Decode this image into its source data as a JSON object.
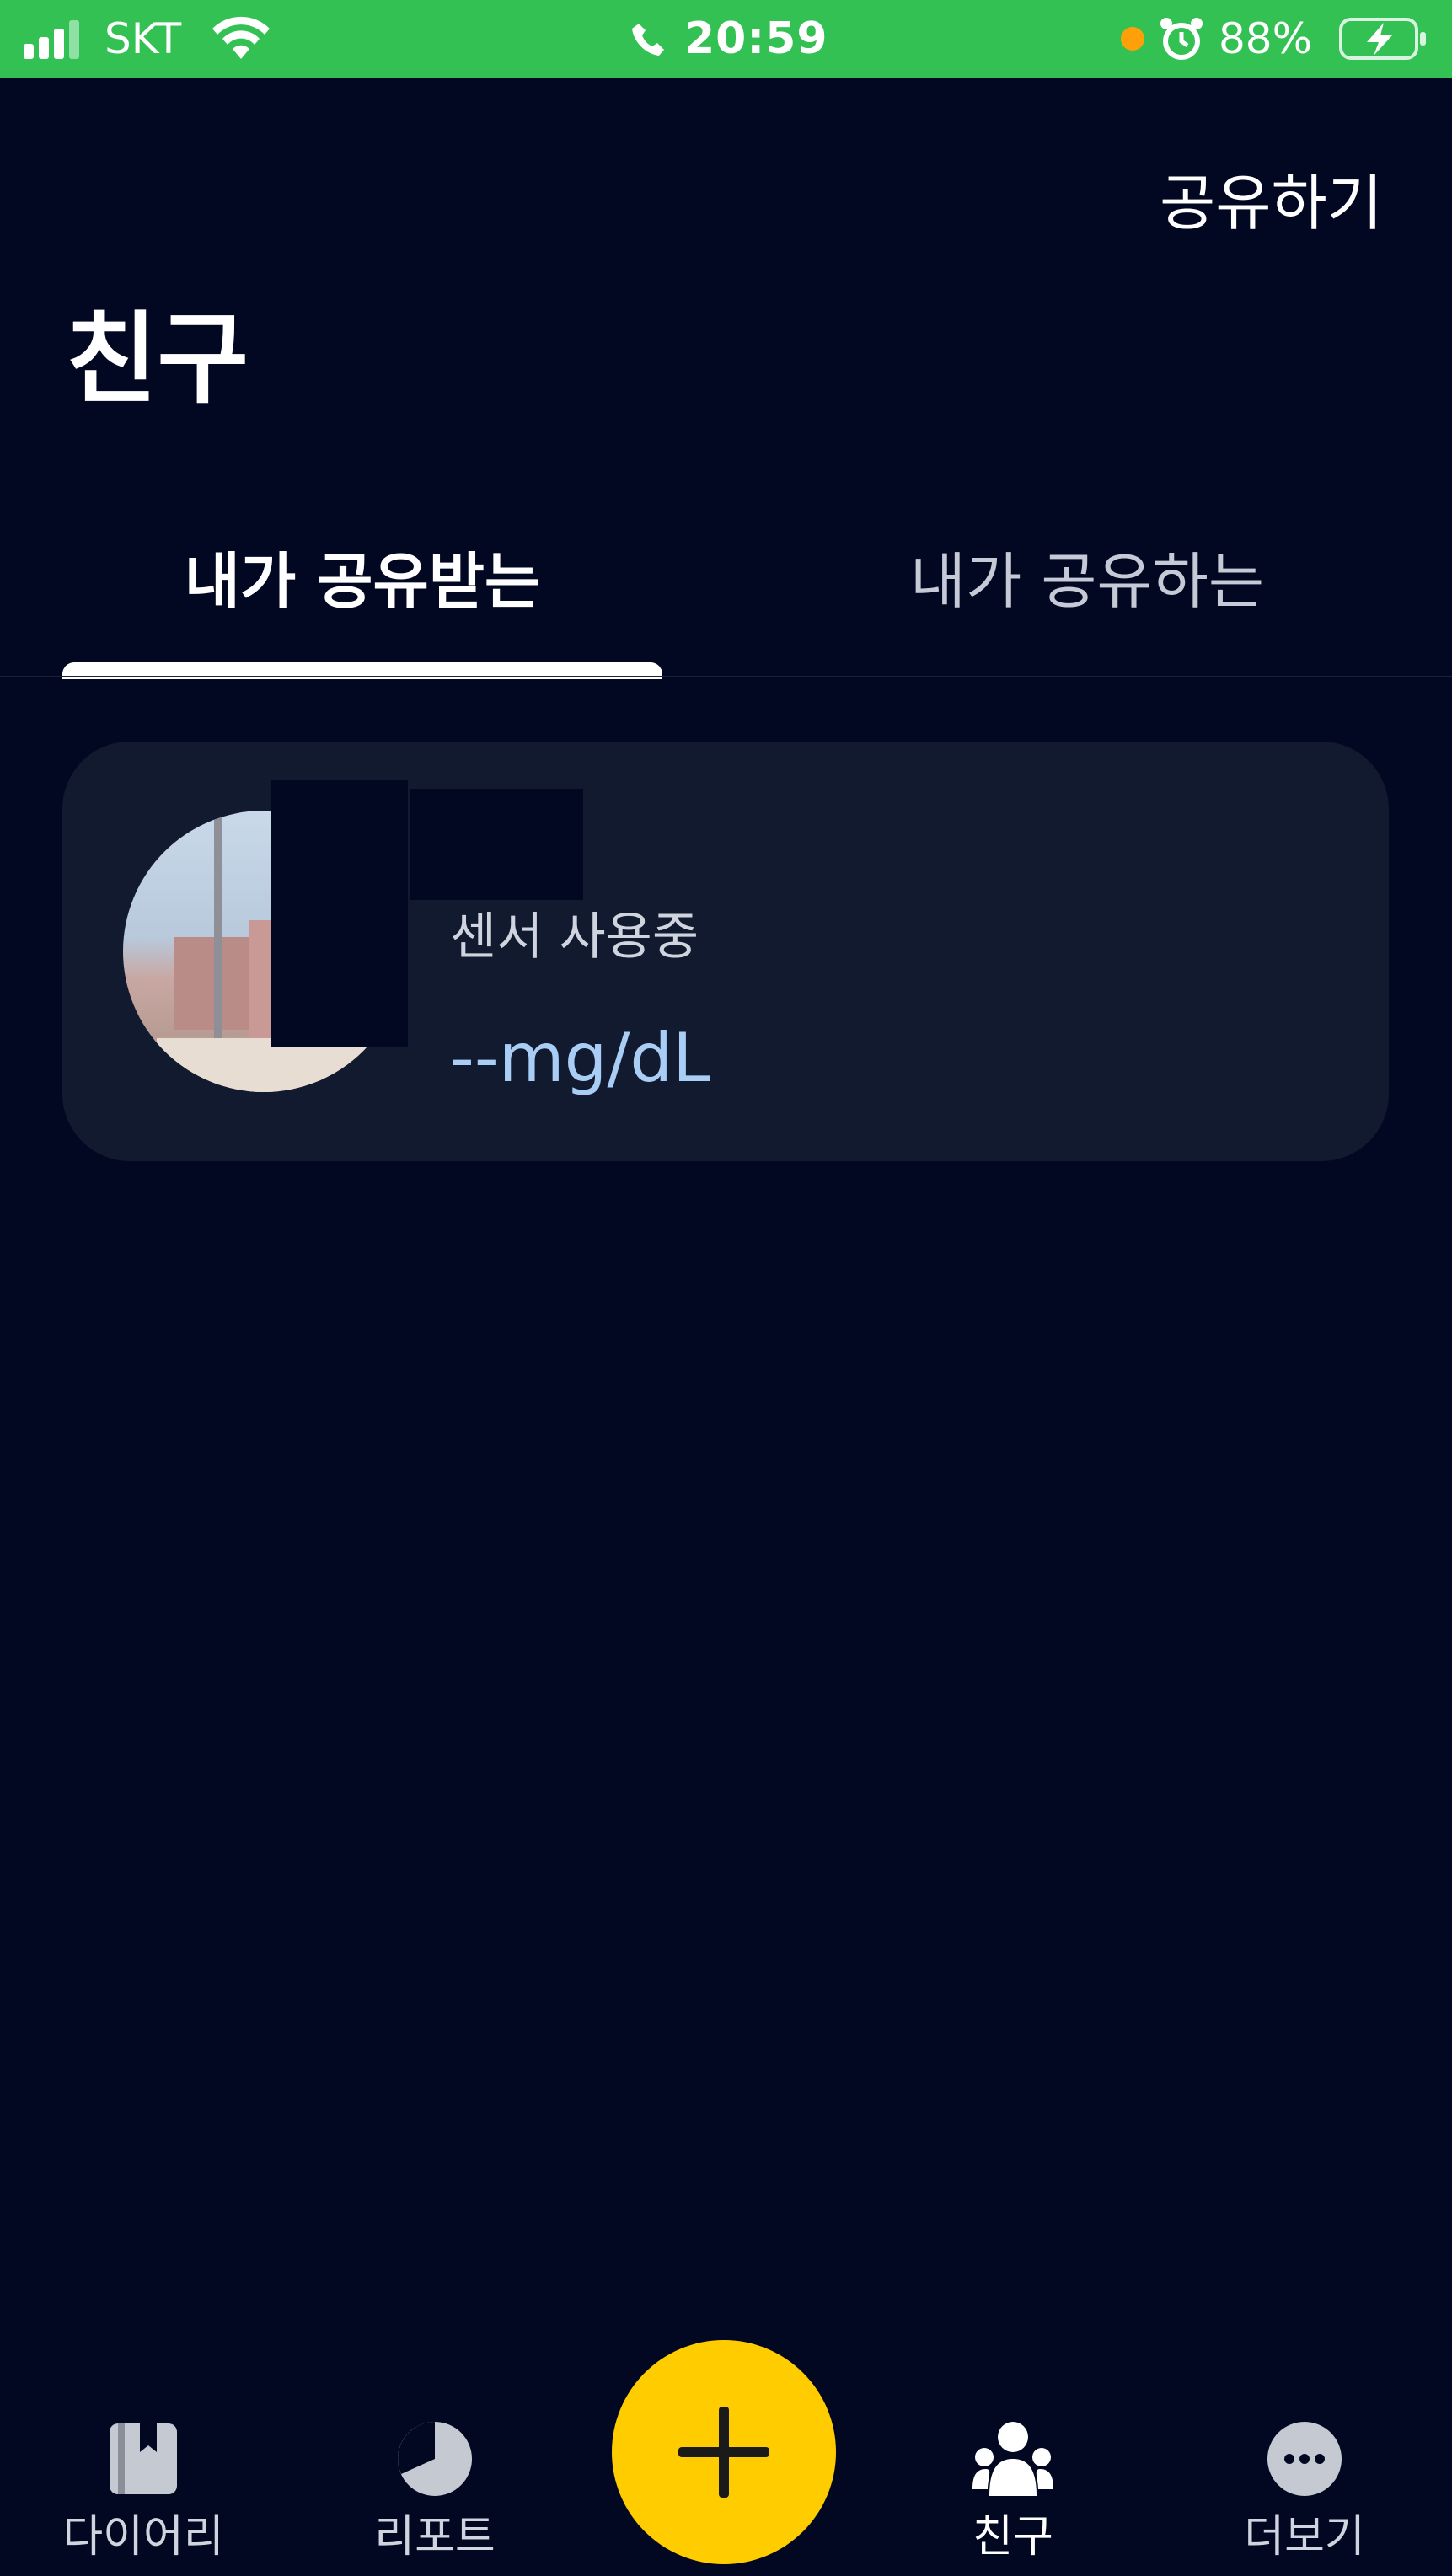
{
  "status_bar": {
    "carrier": "SKT",
    "time": "20:59",
    "battery_percent": "88%",
    "icons": [
      "signal-icon",
      "wifi-icon",
      "call-icon",
      "alarm-icon",
      "battery-charging-icon"
    ],
    "bar_color": "#33c153"
  },
  "header": {
    "share_label": "공유하기",
    "title": "친구"
  },
  "tabs": [
    {
      "label": "내가 공유받는",
      "selected": true
    },
    {
      "label": "내가 공유하는",
      "selected": false
    }
  ],
  "friends": [
    {
      "status": "센서 사용중",
      "glucose": "--mg/dL"
    }
  ],
  "bottom_nav": {
    "items": [
      {
        "label": "다이어리",
        "icon": "diary-icon"
      },
      {
        "label": "리포트",
        "icon": "report-icon"
      },
      {
        "label": "친구",
        "icon": "friends-icon",
        "active": true
      },
      {
        "label": "더보기",
        "icon": "more-icon"
      }
    ],
    "fab_icon": "plus-icon",
    "fab_color": "#ffcc00"
  },
  "colors": {
    "background": "#020822",
    "card": "#111a2e",
    "glucose_text": "#a9cdf5"
  }
}
